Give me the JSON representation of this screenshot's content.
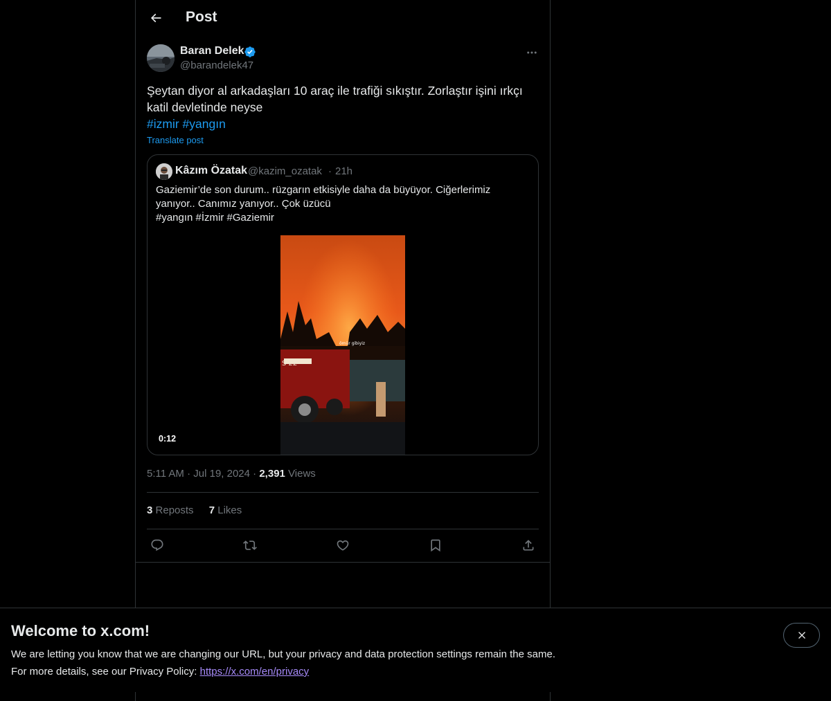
{
  "header": {
    "title": "Post"
  },
  "post": {
    "author_name": "Baran Delek",
    "author_handle": "@barandelek47",
    "text": "Şeytan diyor al arkadaşları 10 araç ile trafiği sıkıştır. Zorlaştır işini ırkçı katil devletinde neyse",
    "hashtags": [
      "#izmir",
      "#yangın"
    ],
    "translate_label": "Translate post",
    "time": "5:11 AM",
    "date": "Jul 19, 2024",
    "views_count": "2,391",
    "views_label": "Views",
    "reposts_count": "3",
    "reposts_label": "Reposts",
    "likes_count": "7",
    "likes_label": "Likes"
  },
  "quote": {
    "author_name": "Kâzım Özatak",
    "author_handle": "@kazim_ozatak",
    "time": "21h",
    "text": "Gaziemir’de son durum.. rüzgarın etkisiyle daha da büyüyor. Ciğerlerimiz yanıyor.. Canımız yanıyor.. Çok üzücü",
    "tags": "#yangın #İzmir #Gaziemir",
    "video_duration": "0:12",
    "video_watermark": "ömür gibiyiz"
  },
  "banner": {
    "title": "Welcome to x.com!",
    "line1": "We are letting you know that we are changing our URL, but your privacy and data protection settings remain the same.",
    "line2_prefix": "For more details, see our Privacy Policy:",
    "link": "https://x.com/en/privacy"
  },
  "colors": {
    "accent": "#1d9bf0",
    "muted": "#71767b",
    "border": "#2f3336",
    "link_visited": "#a78bfa"
  },
  "icons": [
    "back-arrow-icon",
    "verified-badge-icon",
    "more-icon",
    "reply-icon",
    "repost-icon",
    "like-icon",
    "bookmark-icon",
    "share-icon",
    "close-icon"
  ]
}
